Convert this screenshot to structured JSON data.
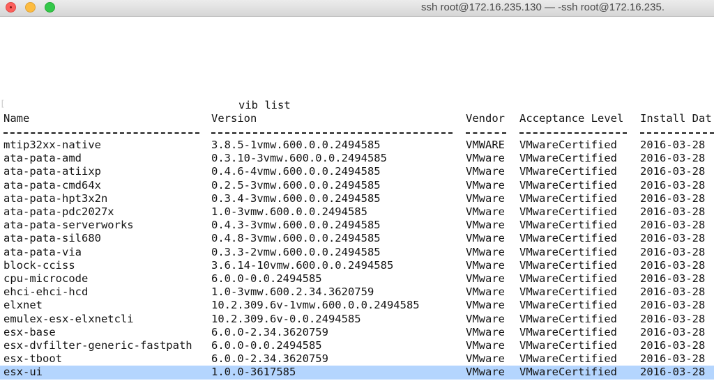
{
  "window": {
    "title": "ssh root@172.16.235.130 — -ssh root@172.16.235."
  },
  "command_title": "vib list",
  "headers": {
    "name": "Name",
    "version": "Version",
    "vendor": "Vendor",
    "acceptance": "Acceptance Level",
    "install_date": "Install Dat"
  },
  "selected_row_index": 17,
  "rows": [
    {
      "name": "mtip32xx-native",
      "version": "3.8.5-1vmw.600.0.0.2494585",
      "vendor": "VMWARE",
      "acceptance": "VMwareCertified",
      "install_date": "2016-03-28"
    },
    {
      "name": "ata-pata-amd",
      "version": "0.3.10-3vmw.600.0.0.2494585",
      "vendor": "VMware",
      "acceptance": "VMwareCertified",
      "install_date": "2016-03-28"
    },
    {
      "name": "ata-pata-atiixp",
      "version": "0.4.6-4vmw.600.0.0.2494585",
      "vendor": "VMware",
      "acceptance": "VMwareCertified",
      "install_date": "2016-03-28"
    },
    {
      "name": "ata-pata-cmd64x",
      "version": "0.2.5-3vmw.600.0.0.2494585",
      "vendor": "VMware",
      "acceptance": "VMwareCertified",
      "install_date": "2016-03-28"
    },
    {
      "name": "ata-pata-hpt3x2n",
      "version": "0.3.4-3vmw.600.0.0.2494585",
      "vendor": "VMware",
      "acceptance": "VMwareCertified",
      "install_date": "2016-03-28"
    },
    {
      "name": "ata-pata-pdc2027x",
      "version": "1.0-3vmw.600.0.0.2494585",
      "vendor": "VMware",
      "acceptance": "VMwareCertified",
      "install_date": "2016-03-28"
    },
    {
      "name": "ata-pata-serverworks",
      "version": "0.4.3-3vmw.600.0.0.2494585",
      "vendor": "VMware",
      "acceptance": "VMwareCertified",
      "install_date": "2016-03-28"
    },
    {
      "name": "ata-pata-sil680",
      "version": "0.4.8-3vmw.600.0.0.2494585",
      "vendor": "VMware",
      "acceptance": "VMwareCertified",
      "install_date": "2016-03-28"
    },
    {
      "name": "ata-pata-via",
      "version": "0.3.3-2vmw.600.0.0.2494585",
      "vendor": "VMware",
      "acceptance": "VMwareCertified",
      "install_date": "2016-03-28"
    },
    {
      "name": "block-cciss",
      "version": "3.6.14-10vmw.600.0.0.2494585",
      "vendor": "VMware",
      "acceptance": "VMwareCertified",
      "install_date": "2016-03-28"
    },
    {
      "name": "cpu-microcode",
      "version": "6.0.0-0.0.2494585",
      "vendor": "VMware",
      "acceptance": "VMwareCertified",
      "install_date": "2016-03-28"
    },
    {
      "name": "ehci-ehci-hcd",
      "version": "1.0-3vmw.600.2.34.3620759",
      "vendor": "VMware",
      "acceptance": "VMwareCertified",
      "install_date": "2016-03-28"
    },
    {
      "name": "elxnet",
      "version": "10.2.309.6v-1vmw.600.0.0.2494585",
      "vendor": "VMware",
      "acceptance": "VMwareCertified",
      "install_date": "2016-03-28"
    },
    {
      "name": "emulex-esx-elxnetcli",
      "version": "10.2.309.6v-0.0.2494585",
      "vendor": "VMware",
      "acceptance": "VMwareCertified",
      "install_date": "2016-03-28"
    },
    {
      "name": "esx-base",
      "version": "6.0.0-2.34.3620759",
      "vendor": "VMware",
      "acceptance": "VMwareCertified",
      "install_date": "2016-03-28"
    },
    {
      "name": "esx-dvfilter-generic-fastpath",
      "version": "6.0.0-0.0.2494585",
      "vendor": "VMware",
      "acceptance": "VMwareCertified",
      "install_date": "2016-03-28"
    },
    {
      "name": "esx-tboot",
      "version": "6.0.0-2.34.3620759",
      "vendor": "VMware",
      "acceptance": "VMwareCertified",
      "install_date": "2016-03-28"
    },
    {
      "name": "esx-ui",
      "version": "1.0.0-3617585",
      "vendor": "VMware",
      "acceptance": "VMwareCertified",
      "install_date": "2016-03-28"
    }
  ]
}
